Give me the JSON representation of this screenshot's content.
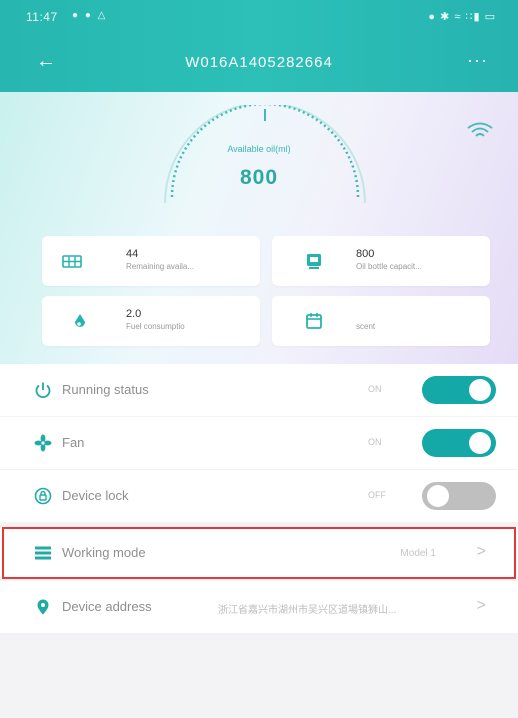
{
  "status_bar": {
    "time": "11:47",
    "left_icons": "● ● △",
    "right_icons": "● ✱ ≈ ∷▮ ▭"
  },
  "nav": {
    "back_symbol": "←",
    "title": "W016A1405282664",
    "more_symbol": "···"
  },
  "gauge": {
    "label": "Available oil(ml)",
    "value": "800"
  },
  "info_cards": [
    {
      "value": "44",
      "label": "Remaining availa...",
      "icon": "grid-icon"
    },
    {
      "value": "800",
      "label": "Oil bottle capacit...",
      "icon": "bottle-icon"
    },
    {
      "value": "2.0",
      "label": "Fuel consumptio",
      "icon": "drop-icon"
    },
    {
      "value": "",
      "label": "scent",
      "icon": "calendar-icon"
    }
  ],
  "settings_rows": {
    "running_status": {
      "label": "Running status",
      "state": "ON",
      "enabled": true
    },
    "fan": {
      "label": "Fan",
      "state": "ON",
      "enabled": true
    },
    "device_lock": {
      "label": "Device lock",
      "state": "OFF",
      "enabled": false
    },
    "working_mode": {
      "label": "Working mode",
      "value": "Model 1"
    },
    "device_address": {
      "label": "Device address",
      "value": "浙江省嘉兴市湖州市吴兴区道場镇狮山..."
    }
  },
  "colors": {
    "accent": "#14a9a6",
    "header": "#2cc0b8",
    "highlight": "#e53838"
  }
}
